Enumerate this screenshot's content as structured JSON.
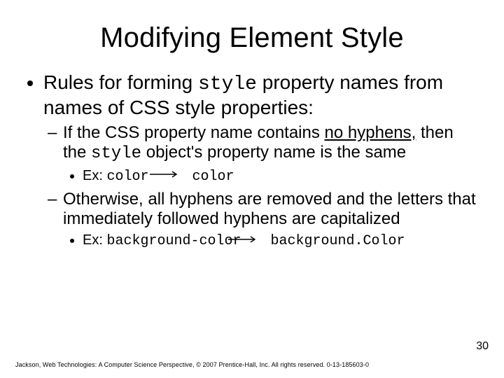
{
  "title": "Modifying Element Style",
  "bullets": {
    "l1": {
      "pre": "Rules for forming ",
      "code": "style",
      "post": " property names from names of CSS style properties:"
    },
    "l2a": {
      "pre": "If the CSS property name contains ",
      "ul": "no hyphens,",
      "mid": " then the ",
      "code": "style",
      "post": " object's property name is the same"
    },
    "l3a": {
      "pre": "Ex: ",
      "c1": "color",
      "gap": "    ",
      "c2": "color"
    },
    "l2b": "Otherwise, all hyphens are removed and the letters that immediately followed hyphens are capitalized",
    "l3b": {
      "pre": "Ex: ",
      "c1": "background-color",
      "gap": "   ",
      "c2": "background.Color"
    }
  },
  "pagenum": "30",
  "footer": "Jackson, Web Technologies: A Computer Science Perspective, © 2007 Prentice-Hall, Inc. All rights reserved. 0-13-185603-0"
}
